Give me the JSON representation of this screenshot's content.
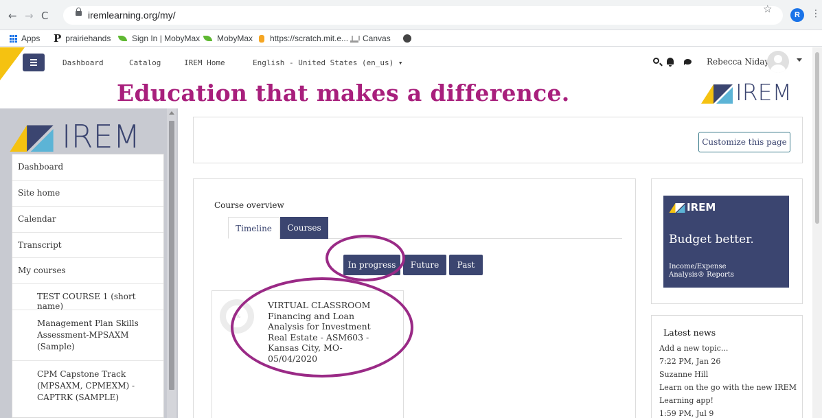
{
  "browser": {
    "back_icon": "arrow-left-icon",
    "forward_icon": "arrow-right-icon",
    "reload_icon": "reload-icon",
    "url": "iremlearning.org/my/",
    "profile_initial": "R",
    "bookmarks": [
      "Apps",
      "prairiehands",
      "Sign In | MobyMax",
      "MobyMax",
      "https://scratch.mit.e...",
      "Canvas"
    ]
  },
  "site_nav": {
    "links": [
      "Dashboard",
      "Catalog",
      "IREM Home",
      "English - United States (en_us) ▾"
    ],
    "user_name": "Rebecca Niday"
  },
  "banner": {
    "tagline": "Education that makes a difference.",
    "logo_word": "IREM"
  },
  "drawer": {
    "logo_word": "IREM",
    "items": [
      "Dashboard",
      "Site home",
      "Calendar",
      "Transcript",
      "My courses"
    ],
    "courses": [
      {
        "lines": [
          "TEST COURSE 1 (short name)"
        ]
      },
      {
        "lines": [
          "Management Plan Skills",
          "Assessment-MPSAXM",
          "(Sample)"
        ]
      },
      {
        "lines": [
          "CPM Capstone Track",
          "(MPSAXM, CPMEXM) -",
          "CAPTRK (SAMPLE)"
        ]
      }
    ]
  },
  "main": {
    "customize_label": "Customize this page",
    "course_overview": {
      "title": "Course overview",
      "tabs": [
        "Timeline",
        "Courses"
      ],
      "active_tab": "Courses",
      "filters": [
        "In progress",
        "Future",
        "Past"
      ],
      "course": {
        "progress_label": "0%",
        "name_lines": [
          "VIRTUAL CLASSROOM",
          "Financing and Loan",
          "Analysis for Investment",
          "Real Estate - ASM603 -",
          "Kansas City, MO-",
          "05/04/2020"
        ]
      }
    }
  },
  "ad": {
    "logo_word": "IREM",
    "headline": "Budget better.",
    "sub_lines": [
      "Income/Expense",
      "Analysis® Reports"
    ]
  },
  "latest_news": {
    "title": "Latest news",
    "lines": [
      "Add a new topic...",
      "7:22 PM, Jan 26",
      "Suzanne Hill",
      "Learn on the go with the new IREM",
      "Learning app!",
      "1:59 PM, Jul 9"
    ]
  },
  "colors": {
    "brand_navy": "#3b4570",
    "accent_magenta": "#a81f7c",
    "accent_yellow": "#f5c211",
    "annotation_circle": "#9a2a86"
  }
}
